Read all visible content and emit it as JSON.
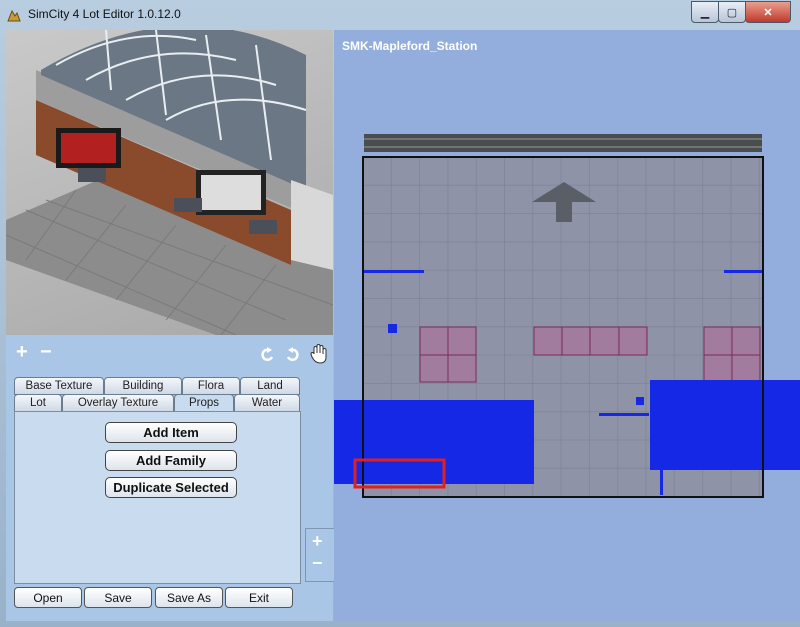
{
  "window": {
    "title": "SimCity 4 Lot Editor 1.0.12.0"
  },
  "lot": {
    "name": "SMK-Mapleford_Station"
  },
  "preview_tools": {
    "add": "+",
    "remove": "−"
  },
  "tabs": {
    "row1": [
      "Base Texture",
      "Building",
      "Flora",
      "Land"
    ],
    "row2": [
      "Lot",
      "Overlay Texture",
      "Props",
      "Water"
    ],
    "active": "Props"
  },
  "props_actions": {
    "add_item": "Add Item",
    "add_family": "Add Family",
    "duplicate": "Duplicate Selected"
  },
  "footer": {
    "open": "Open",
    "save": "Save",
    "save_as": "Save As",
    "exit": "Exit"
  },
  "zoom": {
    "in": "+",
    "out": "−"
  },
  "colors": {
    "selection": "#e02020",
    "lot_bg": "#93aedc",
    "water_overlay": "#1428e6",
    "texture": "#8f93a8"
  }
}
